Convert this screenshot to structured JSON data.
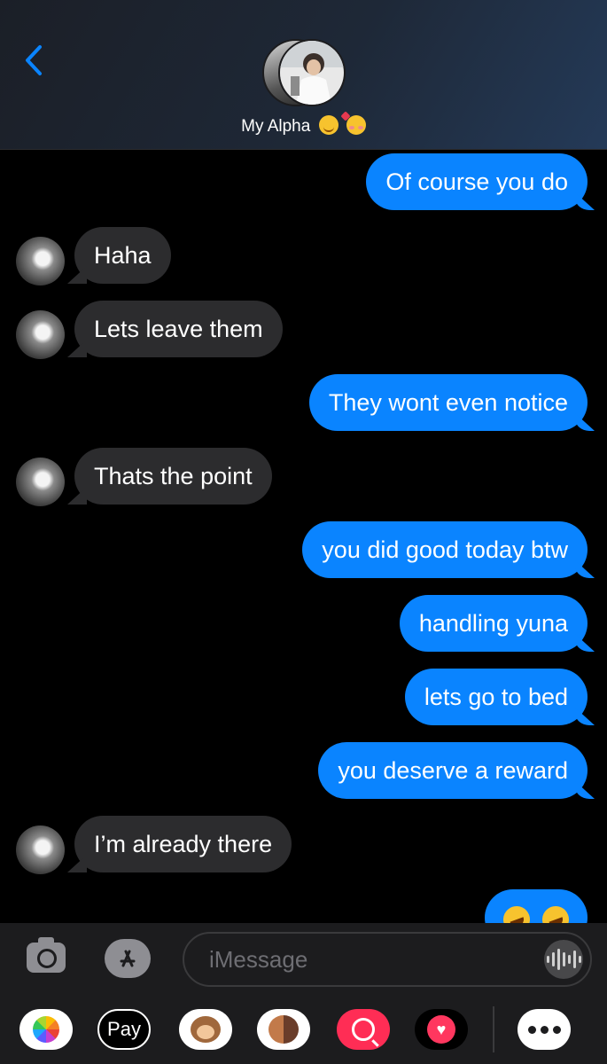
{
  "header": {
    "contact_name": "My Alpha",
    "contact_emojis": [
      "relieved-face",
      "smiling-face-with-hearts"
    ],
    "back_icon": "chevron-left-icon"
  },
  "messages": [
    {
      "direction": "out",
      "text": "Of course you do"
    },
    {
      "direction": "in",
      "text": "Haha"
    },
    {
      "direction": "in",
      "text": "Lets leave them"
    },
    {
      "direction": "out",
      "text": "They wont even notice"
    },
    {
      "direction": "in",
      "text": "Thats the point"
    },
    {
      "direction": "out",
      "text": "you did good today btw"
    },
    {
      "direction": "out",
      "text": "handling yuna"
    },
    {
      "direction": "out",
      "text": "lets go to bed"
    },
    {
      "direction": "out",
      "text": "you deserve a reward"
    },
    {
      "direction": "in",
      "text": "I’m already there"
    },
    {
      "direction": "out",
      "text": "",
      "emojis": [
        "rolling-on-floor-laughing",
        "rolling-on-floor-laughing"
      ]
    }
  ],
  "composer": {
    "placeholder": "iMessage",
    "camera_icon": "camera-icon",
    "apps_icon": "app-store-icon",
    "audio_icon": "audio-waveform-icon"
  },
  "app_drawer": {
    "apps": [
      "photos-icon",
      "apple-pay-icon",
      "animoji-icon",
      "memoji-icon",
      "image-search-icon",
      "digital-touch-icon",
      "more-icon"
    ],
    "apple_pay_label": "Pay",
    "apple_pay_logo": ""
  },
  "colors": {
    "outgoing_bubble": "#0a84ff",
    "incoming_bubble": "#2c2c2e",
    "background": "#000000"
  }
}
